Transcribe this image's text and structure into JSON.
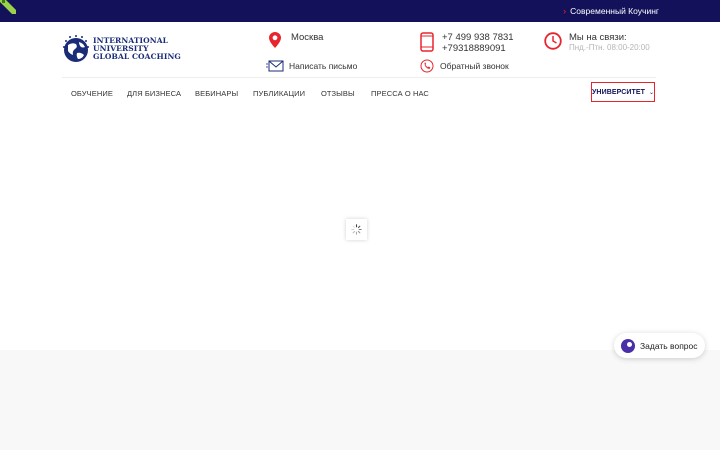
{
  "topbar": {
    "link_label": "Современный Коучинг"
  },
  "logo": {
    "line1": "INTERNATIONAL",
    "line2": "UNIVERSITY",
    "line3": "GLOBAL COACHING"
  },
  "contacts": {
    "city": "Москва",
    "write_letter": "Написать письмо",
    "phone1": "+7 499 938 7831",
    "phone2": "+79318889091",
    "callback": "Обратный звонок",
    "hours_title": "Мы на связи:",
    "hours_value": "Пнд.-Птн. 08:00-20:00"
  },
  "nav": {
    "items": [
      "Обучение",
      "Для бизнеса",
      "Вебинары",
      "Публикации",
      "Отзывы",
      "Пресса о нас"
    ],
    "university": "Университет"
  },
  "chat": {
    "label": "Задать вопрос"
  },
  "colors": {
    "brand_navy": "#13115a",
    "accent_red": "#e8252e"
  }
}
